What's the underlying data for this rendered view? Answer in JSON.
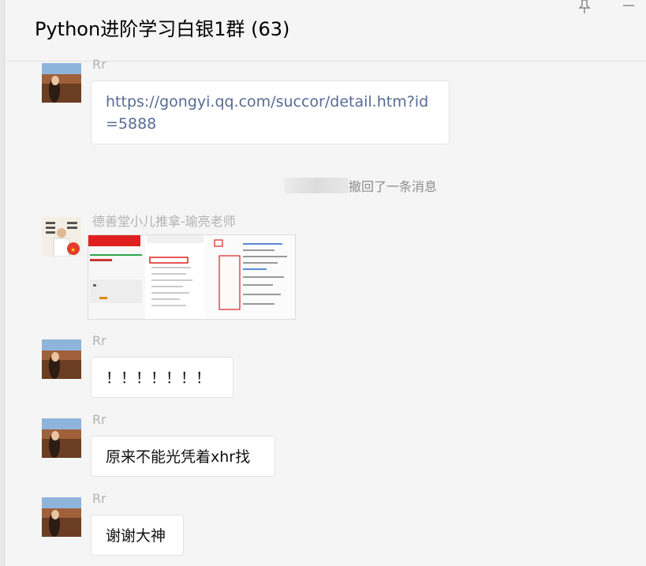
{
  "header": {
    "title": "Python进阶学习白银1群 (63)"
  },
  "system_message": {
    "text": "撤回了一条消息"
  },
  "messages": [
    {
      "sender": "Rr",
      "text": "https://gongyi.qq.com/succor/detail.htm?id=5888"
    },
    {
      "sender": "德善堂小儿推拿-瑜亮老师",
      "type": "image"
    },
    {
      "sender": "Rr",
      "text": "！！！！！！！"
    },
    {
      "sender": "Rr",
      "text": "原来不能光凭着xhr找"
    },
    {
      "sender": "Rr",
      "text": "谢谢大神"
    }
  ],
  "colors": {
    "background": "#f5f5f5",
    "link": "#576b95",
    "sender": "#b2b2b2",
    "bubble": "#ffffff"
  }
}
